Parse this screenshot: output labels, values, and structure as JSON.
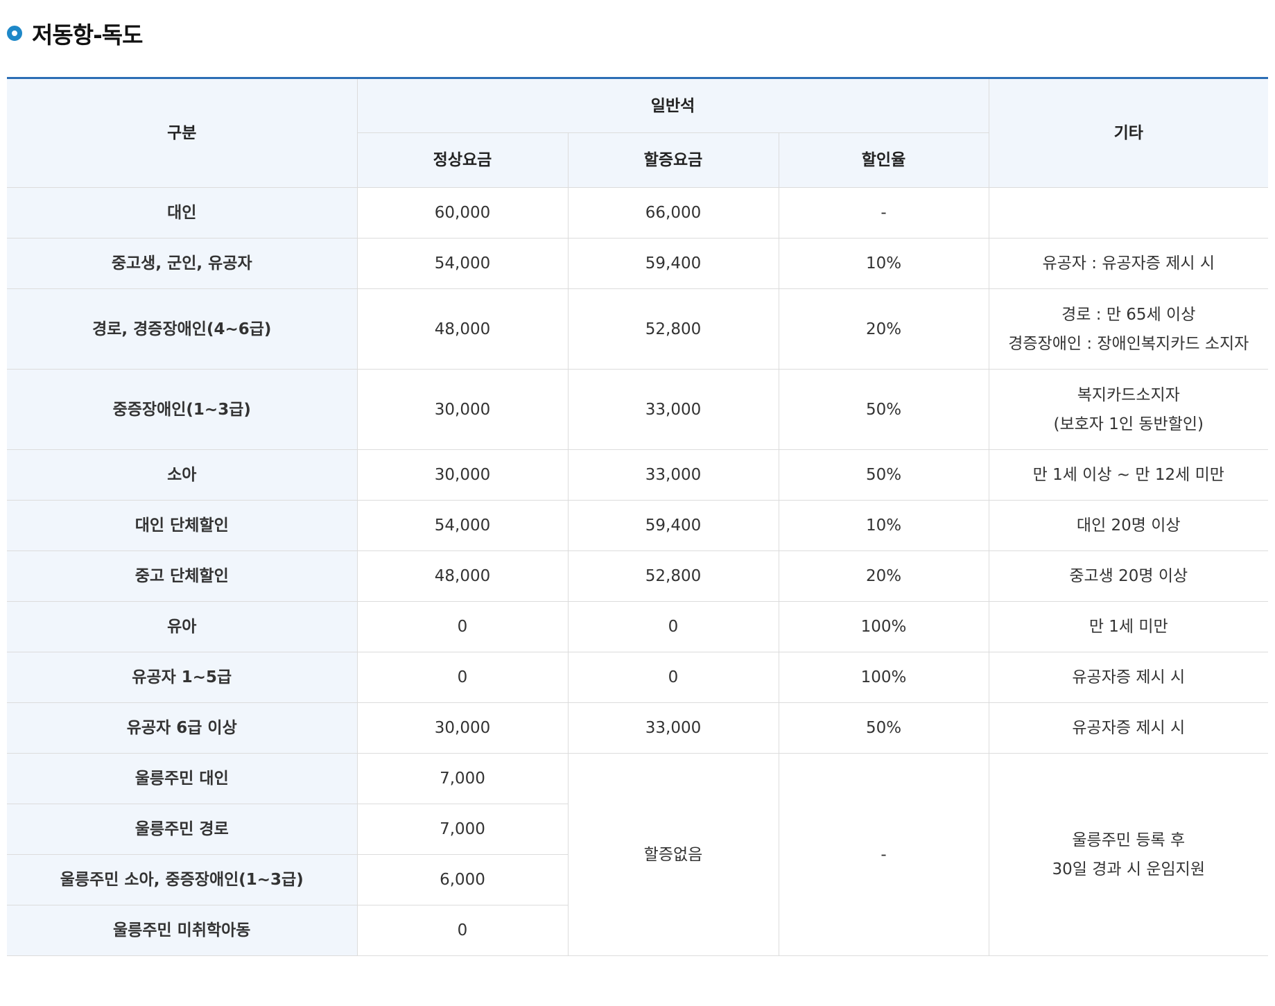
{
  "section_title": "저동항-독도",
  "table": {
    "headers": {
      "category": "구분",
      "general_seat": "일반석",
      "regular_fare": "정상요금",
      "surcharge_fare": "할증요금",
      "discount_rate": "할인율",
      "etc": "기타"
    },
    "rows": [
      {
        "category": "대인",
        "regular": "60,000",
        "surcharge": "66,000",
        "discount": "-",
        "note": []
      },
      {
        "category": "중고생, 군인, 유공자",
        "regular": "54,000",
        "surcharge": "59,400",
        "discount": "10%",
        "note": [
          "유공자 : 유공자증 제시 시"
        ]
      },
      {
        "category": "경로, 경증장애인(4~6급)",
        "regular": "48,000",
        "surcharge": "52,800",
        "discount": "20%",
        "note": [
          "경로 : 만 65세 이상",
          "경증장애인 : 장애인복지카드 소지자"
        ]
      },
      {
        "category": "중증장애인(1~3급)",
        "regular": "30,000",
        "surcharge": "33,000",
        "discount": "50%",
        "note": [
          "복지카드소지자",
          "(보호자 1인 동반할인)"
        ]
      },
      {
        "category": "소아",
        "regular": "30,000",
        "surcharge": "33,000",
        "discount": "50%",
        "note": [
          "만 1세 이상 ~ 만 12세 미만"
        ]
      },
      {
        "category": "대인 단체할인",
        "regular": "54,000",
        "surcharge": "59,400",
        "discount": "10%",
        "note": [
          "대인 20명 이상"
        ]
      },
      {
        "category": "중고 단체할인",
        "regular": "48,000",
        "surcharge": "52,800",
        "discount": "20%",
        "note": [
          "중고생 20명 이상"
        ]
      },
      {
        "category": "유아",
        "regular": "0",
        "surcharge": "0",
        "discount": "100%",
        "note": [
          "만 1세 미만"
        ]
      },
      {
        "category": "유공자 1~5급",
        "regular": "0",
        "surcharge": "0",
        "discount": "100%",
        "note": [
          "유공자증 제시 시"
        ]
      },
      {
        "category": "유공자 6급 이상",
        "regular": "30,000",
        "surcharge": "33,000",
        "discount": "50%",
        "note": [
          "유공자증 제시 시"
        ]
      }
    ],
    "resident_rows": [
      {
        "category": "울릉주민 대인",
        "regular": "7,000"
      },
      {
        "category": "울릉주민 경로",
        "regular": "7,000"
      },
      {
        "category": "울릉주민 소아, 중증장애인(1~3급)",
        "regular": "6,000"
      },
      {
        "category": "울릉주민 미취학아동",
        "regular": "0"
      }
    ],
    "resident_group": {
      "surcharge": "할증없음",
      "discount": "-",
      "note": [
        "울릉주민 등록 후",
        "30일 경과 시 운임지원"
      ]
    }
  },
  "colors": {
    "accent": "#2c6eb5",
    "bullet": "#1e88c8",
    "header_bg": "#f1f6fc",
    "border": "#dcdcdc"
  }
}
